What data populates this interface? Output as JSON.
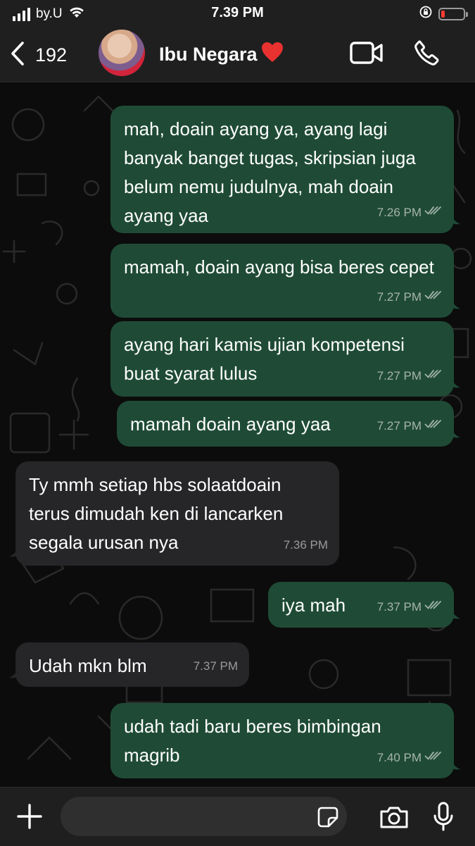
{
  "status_bar": {
    "carrier": "by.U",
    "time": "7.39 PM",
    "battery_level": 0.15
  },
  "header": {
    "back_count": "192",
    "contact_name": "Ibu Negara",
    "contact_emoji": "❤️",
    "icons": [
      "back-chevron-icon",
      "video-call-icon",
      "phone-icon"
    ]
  },
  "messages": [
    {
      "direction": "out",
      "text": "mah, doain ayang ya, ayang lagi banyak banget tugas, skripsian juga belum nemu judulnya, mah doain ayang yaa",
      "time": "7.26 PM",
      "read": true
    },
    {
      "direction": "out",
      "text": "mamah, doain ayang bisa beres cepet",
      "time": "7.27 PM",
      "read": true
    },
    {
      "direction": "out",
      "text": "ayang hari kamis ujian kompetensi buat syarat lulus",
      "time": "7.27 PM",
      "read": true
    },
    {
      "direction": "out",
      "text": "mamah doain ayang yaa",
      "time": "7.27 PM",
      "read": true
    },
    {
      "direction": "in",
      "text": "Ty mmh setiap hbs solaatdoain terus dimudah ken di lancarken segala urusan nya",
      "time": "7.36 PM"
    },
    {
      "direction": "out",
      "text": "iya mah",
      "time": "7.37 PM",
      "read": true
    },
    {
      "direction": "in",
      "text": "Udah mkn blm",
      "time": "7.37 PM"
    },
    {
      "direction": "out",
      "text": "udah tadi baru beres bimbingan magrib",
      "time": "7.40 PM",
      "read": true
    }
  ],
  "composer": {
    "placeholder": "",
    "icons": [
      "plus-icon",
      "sticker-icon",
      "camera-icon",
      "microphone-icon"
    ]
  },
  "colors": {
    "outgoing_bubble": "#1f4b36",
    "incoming_bubble": "#262628",
    "bar_background": "#1f1f1f",
    "battery_low": "#ff3b30"
  }
}
